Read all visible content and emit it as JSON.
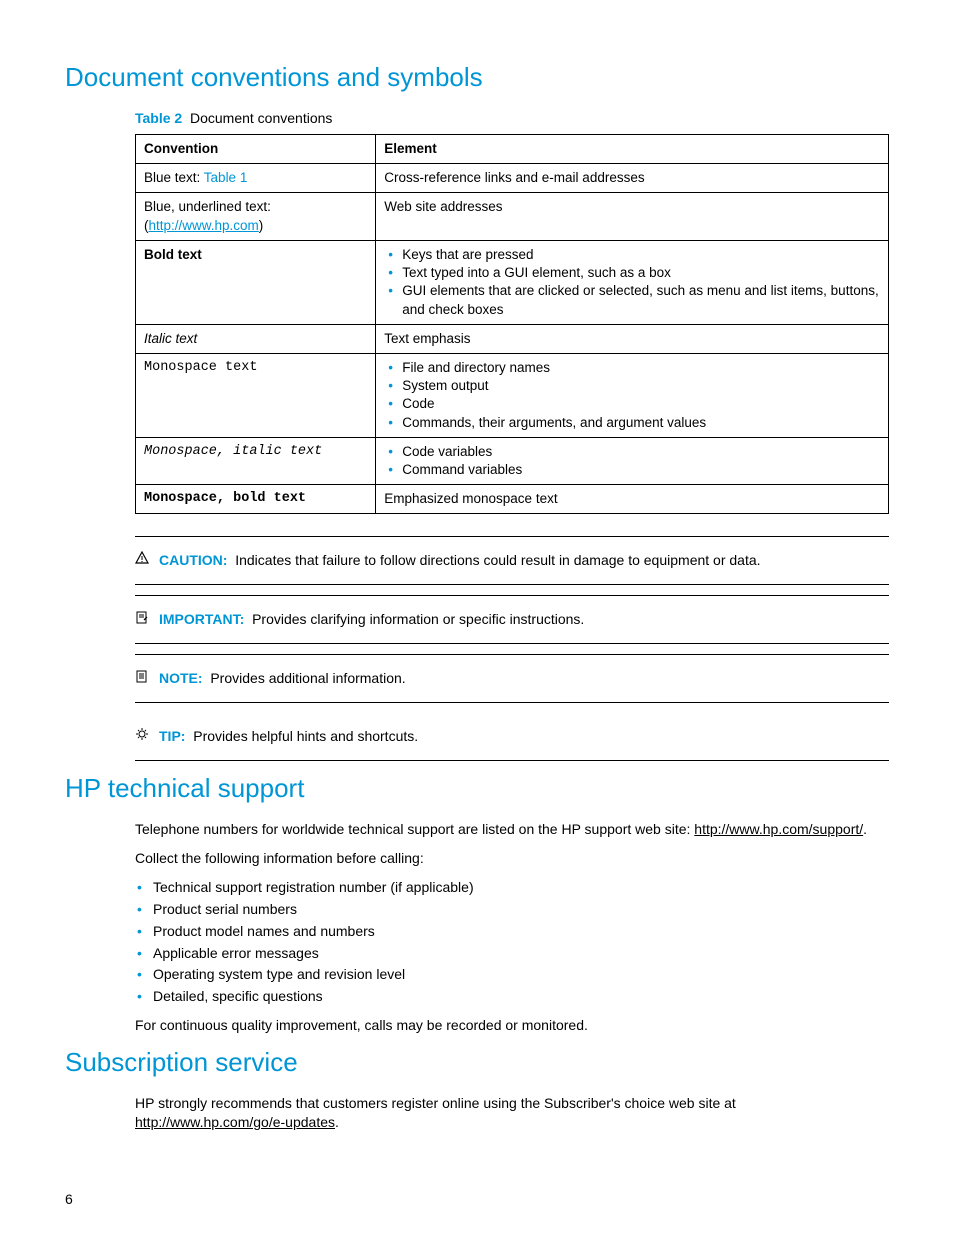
{
  "h1_1": "Document conventions and symbols",
  "table": {
    "caption_label": "Table 2",
    "caption_text": "Document conventions",
    "head_conv": "Convention",
    "head_elem": "Element",
    "r1_pre": "Blue text: ",
    "r1_link": "Table 1",
    "r1_elem": "Cross-reference links and e-mail addresses",
    "r2_pre": "Blue, underlined text: (",
    "r2_link": "http://www.hp.com",
    "r2_post": ")",
    "r2_elem": "Web site addresses",
    "r3_conv": "Bold text",
    "r3_li1": "Keys that are pressed",
    "r3_li2": "Text typed into a GUI element, such as a box",
    "r3_li3": "GUI elements that are clicked or selected, such as menu and list items, buttons, and check boxes",
    "r4_conv": "Italic text",
    "r4_elem": "Text emphasis",
    "r5_conv": "Monospace text",
    "r5_li1": "File and directory names",
    "r5_li2": "System output",
    "r5_li3": "Code",
    "r5_li4": "Commands, their arguments, and argument values",
    "r6_conv": "Monospace, italic text",
    "r6_li1": "Code variables",
    "r6_li2": "Command variables",
    "r7_conv": "Monospace, bold text",
    "r7_elem": "Emphasized monospace text"
  },
  "admon": {
    "caution_label": "CAUTION:",
    "caution_text": "Indicates that failure to follow directions could result in damage to equipment or data.",
    "important_label": "IMPORTANT:",
    "important_text": "Provides clarifying information or specific instructions.",
    "note_label": "NOTE:",
    "note_text": "Provides additional information.",
    "tip_label": "TIP:",
    "tip_text": "Provides helpful hints and shortcuts."
  },
  "h1_2": "HP technical support",
  "support": {
    "p1_pre": "Telephone numbers for worldwide technical support are listed on the HP support web site: ",
    "p1_link": "http://www.hp.com/support/",
    "p1_post": ".",
    "p2": "Collect the following information before calling:",
    "li1": "Technical support registration number (if applicable)",
    "li2": "Product serial numbers",
    "li3": "Product model names and numbers",
    "li4": "Applicable error messages",
    "li5": "Operating system type and revision level",
    "li6": "Detailed, specific questions",
    "p3": "For continuous quality improvement, calls may be recorded or monitored."
  },
  "h1_3": "Subscription service",
  "sub": {
    "p1_pre": "HP strongly recommends that customers register online using the Subscriber's choice web site at ",
    "p1_link": "http://www.hp.com/go/e-updates",
    "p1_post": "."
  },
  "page_num": "6"
}
